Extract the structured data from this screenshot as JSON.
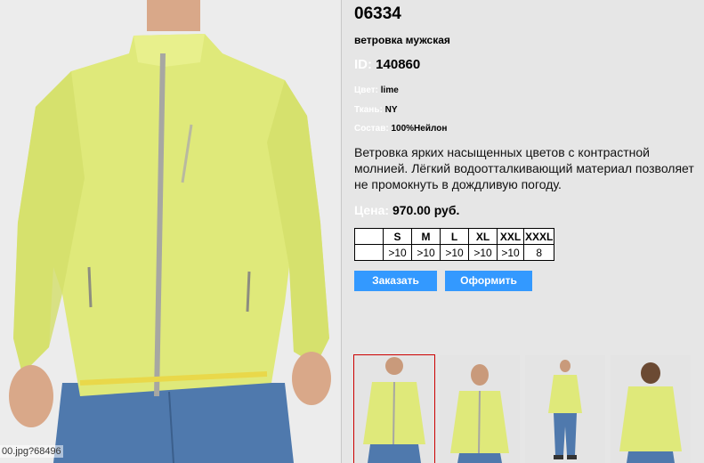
{
  "photo_caption": "00.jpg?68496",
  "product": {
    "sku": "06334",
    "subtitle": "ветровка мужская",
    "id_label": "ID:",
    "id_value": "140860",
    "attributes": [
      {
        "label": "Цвет:",
        "value": "lime"
      },
      {
        "label": "Ткань:",
        "value": "NY"
      },
      {
        "label": "Состав:",
        "value": "100%Нейлон"
      }
    ],
    "description": "Ветровка ярких насыщенных цветов с контрастной молнией. Лёгкий водоотталкивающий материал позволяет не промокнуть в дождливую погоду.",
    "price_label": "Цена:",
    "price_value": "970.00 руб."
  },
  "sizes": {
    "headers": [
      "",
      "S",
      "M",
      "L",
      "XL",
      "XXL",
      "XXXL"
    ],
    "stock": [
      "",
      ">10",
      ">10",
      ">10",
      ">10",
      ">10",
      "8"
    ]
  },
  "buttons": {
    "order": "Заказать",
    "checkout": "Оформить"
  },
  "colors": {
    "accent": "#3399ff",
    "jacket": "#e0ec7c",
    "jeans": "#4f79ad",
    "active_thumb_border": "#cc0000"
  }
}
